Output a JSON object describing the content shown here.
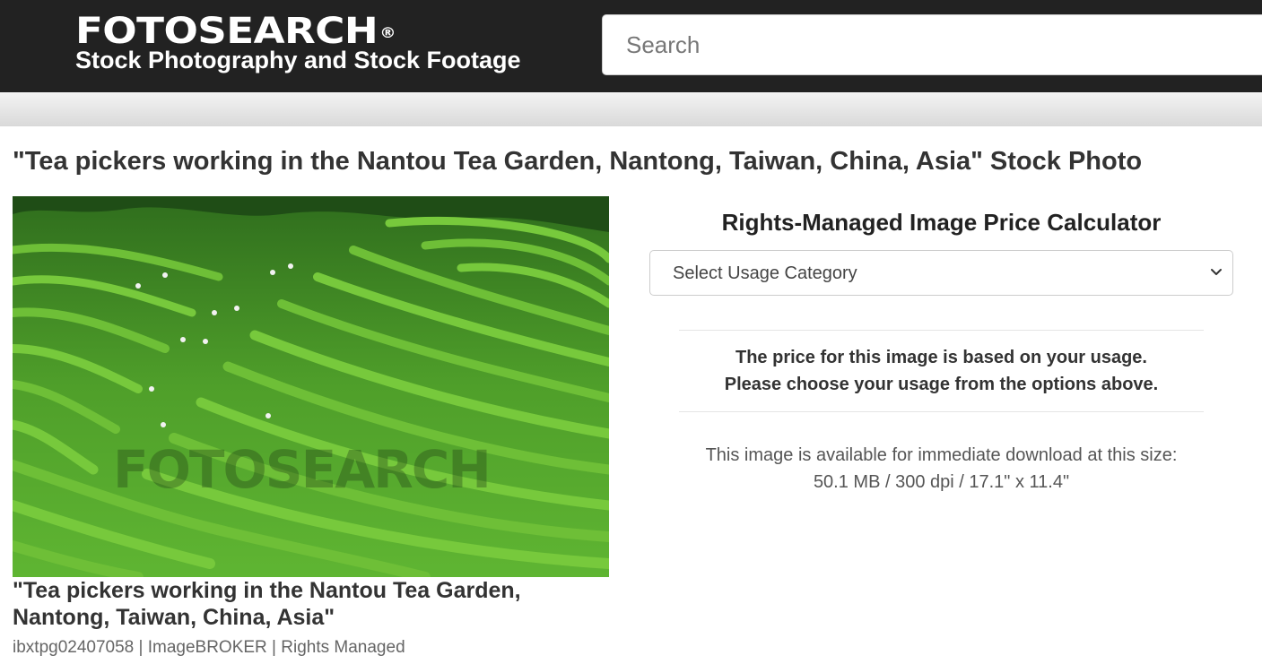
{
  "header": {
    "logo_text": "FOTOSEARCH",
    "logo_registered": "®",
    "tagline": "Stock Photography and Stock Footage",
    "search_placeholder": "Search",
    "background_color": "#222222"
  },
  "page": {
    "title": "\"Tea pickers working in the Nantou Tea Garden, Nantong, Taiwan, China, Asia\" Stock Photo"
  },
  "image": {
    "icon": "tea-garden-photo",
    "watermark": "FOTOSEARCH",
    "caption_line1": "\"Tea pickers working in the Nantou Tea Garden,",
    "caption_line2": "Nantong, Taiwan, China, Asia\"",
    "meta": "ibxtpg02407058 | ImageBROKER | Rights Managed"
  },
  "calculator": {
    "title": "Rights-Managed Image Price Calculator",
    "select_label": "Select Usage Category",
    "price_note_line1": "The price for this image is based on your usage.",
    "price_note_line2": "Please choose your usage from the options above.",
    "availability_line1": "This image is available for immediate download at this size:",
    "availability_line2": "50.1 MB / 300 dpi / 17.1\" x 11.4\""
  }
}
